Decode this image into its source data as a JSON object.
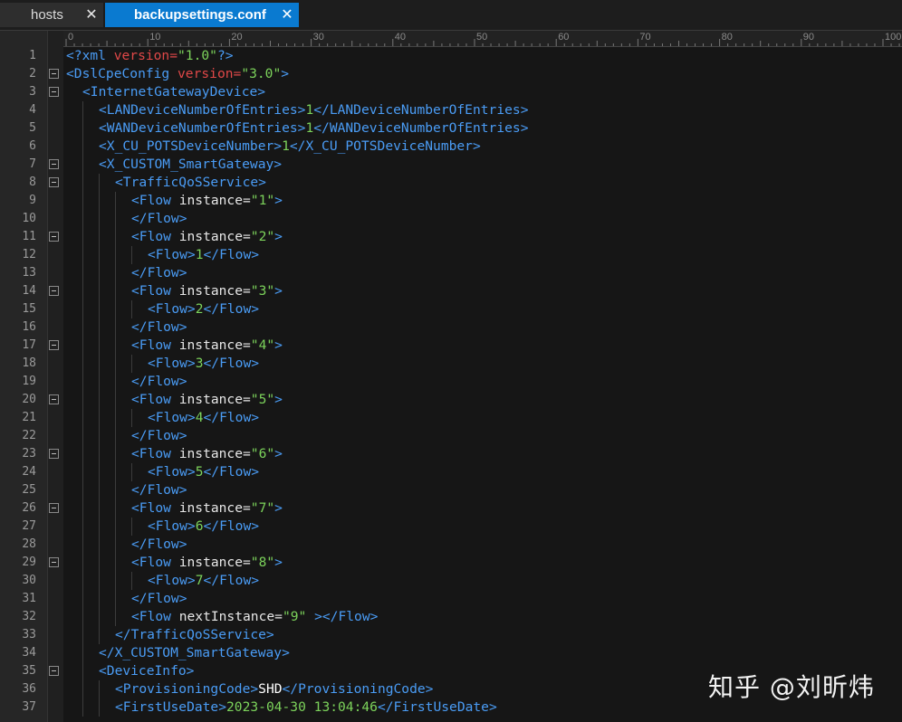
{
  "tabs": [
    {
      "label": "hosts",
      "active": false
    },
    {
      "label": "backupsettings.conf",
      "active": true
    }
  ],
  "icons": {
    "close": "close-icon",
    "fold": "fold-minus-icon"
  },
  "ruler": [
    "0",
    "10",
    "20",
    "30",
    "40",
    "50",
    "60",
    "70",
    "80",
    "90",
    "100"
  ],
  "colors": {
    "tag": "#4a9cf5",
    "attr": "#e04848",
    "string": "#7cd35b",
    "text": "#7cd35b",
    "accent_tab": "#0a7ad0"
  },
  "lines": [
    {
      "n": "1",
      "indent": 0,
      "fold": false,
      "tokens": [
        [
          "tag",
          "<?xml "
        ],
        [
          "attr",
          "version="
        ],
        [
          "str",
          "\"1.0\""
        ],
        [
          "tag",
          "?>"
        ]
      ]
    },
    {
      "n": "2",
      "indent": 0,
      "fold": true,
      "tokens": [
        [
          "tag",
          "<DslCpeConfig "
        ],
        [
          "attr",
          "version="
        ],
        [
          "str",
          "\"3.0\""
        ],
        [
          "tag",
          ">"
        ]
      ]
    },
    {
      "n": "3",
      "indent": 1,
      "fold": true,
      "tokens": [
        [
          "tag",
          "<InternetGatewayDevice>"
        ]
      ]
    },
    {
      "n": "4",
      "indent": 2,
      "fold": false,
      "tokens": [
        [
          "tag",
          "<LANDeviceNumberOfEntries>"
        ],
        [
          "txt",
          "1"
        ],
        [
          "tag",
          "</LANDeviceNumberOfEntries>"
        ]
      ]
    },
    {
      "n": "5",
      "indent": 2,
      "fold": false,
      "tokens": [
        [
          "tag",
          "<WANDeviceNumberOfEntries>"
        ],
        [
          "txt",
          "1"
        ],
        [
          "tag",
          "</WANDeviceNumberOfEntries>"
        ]
      ]
    },
    {
      "n": "6",
      "indent": 2,
      "fold": false,
      "tokens": [
        [
          "tag",
          "<X_CU_POTSDeviceNumber>"
        ],
        [
          "txt",
          "1"
        ],
        [
          "tag",
          "</X_CU_POTSDeviceNumber>"
        ]
      ]
    },
    {
      "n": "7",
      "indent": 2,
      "fold": true,
      "tokens": [
        [
          "tag",
          "<X_CUSTOM_SmartGateway>"
        ]
      ]
    },
    {
      "n": "8",
      "indent": 3,
      "fold": true,
      "tokens": [
        [
          "tag",
          "<TrafficQoSService>"
        ]
      ]
    },
    {
      "n": "9",
      "indent": 4,
      "fold": false,
      "tokens": [
        [
          "tag",
          "<Flow "
        ],
        [
          "plain",
          "instance="
        ],
        [
          "str",
          "\"1\""
        ],
        [
          "tag",
          ">"
        ]
      ]
    },
    {
      "n": "10",
      "indent": 4,
      "fold": false,
      "tokens": [
        [
          "tag",
          "</Flow>"
        ]
      ]
    },
    {
      "n": "11",
      "indent": 4,
      "fold": true,
      "tokens": [
        [
          "tag",
          "<Flow "
        ],
        [
          "plain",
          "instance="
        ],
        [
          "str",
          "\"2\""
        ],
        [
          "tag",
          ">"
        ]
      ]
    },
    {
      "n": "12",
      "indent": 5,
      "fold": false,
      "tokens": [
        [
          "tag",
          "<Flow>"
        ],
        [
          "txt",
          "1"
        ],
        [
          "tag",
          "</Flow>"
        ]
      ]
    },
    {
      "n": "13",
      "indent": 4,
      "fold": false,
      "tokens": [
        [
          "tag",
          "</Flow>"
        ]
      ]
    },
    {
      "n": "14",
      "indent": 4,
      "fold": true,
      "tokens": [
        [
          "tag",
          "<Flow "
        ],
        [
          "plain",
          "instance="
        ],
        [
          "str",
          "\"3\""
        ],
        [
          "tag",
          ">"
        ]
      ]
    },
    {
      "n": "15",
      "indent": 5,
      "fold": false,
      "tokens": [
        [
          "tag",
          "<Flow>"
        ],
        [
          "txt",
          "2"
        ],
        [
          "tag",
          "</Flow>"
        ]
      ]
    },
    {
      "n": "16",
      "indent": 4,
      "fold": false,
      "tokens": [
        [
          "tag",
          "</Flow>"
        ]
      ]
    },
    {
      "n": "17",
      "indent": 4,
      "fold": true,
      "tokens": [
        [
          "tag",
          "<Flow "
        ],
        [
          "plain",
          "instance="
        ],
        [
          "str",
          "\"4\""
        ],
        [
          "tag",
          ">"
        ]
      ]
    },
    {
      "n": "18",
      "indent": 5,
      "fold": false,
      "tokens": [
        [
          "tag",
          "<Flow>"
        ],
        [
          "txt",
          "3"
        ],
        [
          "tag",
          "</Flow>"
        ]
      ]
    },
    {
      "n": "19",
      "indent": 4,
      "fold": false,
      "tokens": [
        [
          "tag",
          "</Flow>"
        ]
      ]
    },
    {
      "n": "20",
      "indent": 4,
      "fold": true,
      "tokens": [
        [
          "tag",
          "<Flow "
        ],
        [
          "plain",
          "instance="
        ],
        [
          "str",
          "\"5\""
        ],
        [
          "tag",
          ">"
        ]
      ]
    },
    {
      "n": "21",
      "indent": 5,
      "fold": false,
      "tokens": [
        [
          "tag",
          "<Flow>"
        ],
        [
          "txt",
          "4"
        ],
        [
          "tag",
          "</Flow>"
        ]
      ]
    },
    {
      "n": "22",
      "indent": 4,
      "fold": false,
      "tokens": [
        [
          "tag",
          "</Flow>"
        ]
      ]
    },
    {
      "n": "23",
      "indent": 4,
      "fold": true,
      "tokens": [
        [
          "tag",
          "<Flow "
        ],
        [
          "plain",
          "instance="
        ],
        [
          "str",
          "\"6\""
        ],
        [
          "tag",
          ">"
        ]
      ]
    },
    {
      "n": "24",
      "indent": 5,
      "fold": false,
      "tokens": [
        [
          "tag",
          "<Flow>"
        ],
        [
          "txt",
          "5"
        ],
        [
          "tag",
          "</Flow>"
        ]
      ]
    },
    {
      "n": "25",
      "indent": 4,
      "fold": false,
      "tokens": [
        [
          "tag",
          "</Flow>"
        ]
      ]
    },
    {
      "n": "26",
      "indent": 4,
      "fold": true,
      "tokens": [
        [
          "tag",
          "<Flow "
        ],
        [
          "plain",
          "instance="
        ],
        [
          "str",
          "\"7\""
        ],
        [
          "tag",
          ">"
        ]
      ]
    },
    {
      "n": "27",
      "indent": 5,
      "fold": false,
      "tokens": [
        [
          "tag",
          "<Flow>"
        ],
        [
          "txt",
          "6"
        ],
        [
          "tag",
          "</Flow>"
        ]
      ]
    },
    {
      "n": "28",
      "indent": 4,
      "fold": false,
      "tokens": [
        [
          "tag",
          "</Flow>"
        ]
      ]
    },
    {
      "n": "29",
      "indent": 4,
      "fold": true,
      "tokens": [
        [
          "tag",
          "<Flow "
        ],
        [
          "plain",
          "instance="
        ],
        [
          "str",
          "\"8\""
        ],
        [
          "tag",
          ">"
        ]
      ]
    },
    {
      "n": "30",
      "indent": 5,
      "fold": false,
      "tokens": [
        [
          "tag",
          "<Flow>"
        ],
        [
          "txt",
          "7"
        ],
        [
          "tag",
          "</Flow>"
        ]
      ]
    },
    {
      "n": "31",
      "indent": 4,
      "fold": false,
      "tokens": [
        [
          "tag",
          "</Flow>"
        ]
      ]
    },
    {
      "n": "32",
      "indent": 4,
      "fold": false,
      "tokens": [
        [
          "tag",
          "<Flow "
        ],
        [
          "plain",
          "nextInstance="
        ],
        [
          "str",
          "\"9\""
        ],
        [
          "tag",
          " ></Flow>"
        ]
      ]
    },
    {
      "n": "33",
      "indent": 3,
      "fold": false,
      "tokens": [
        [
          "tag",
          "</TrafficQoSService>"
        ]
      ]
    },
    {
      "n": "34",
      "indent": 2,
      "fold": false,
      "tokens": [
        [
          "tag",
          "</X_CUSTOM_SmartGateway>"
        ]
      ]
    },
    {
      "n": "35",
      "indent": 2,
      "fold": true,
      "tokens": [
        [
          "tag",
          "<DeviceInfo>"
        ]
      ]
    },
    {
      "n": "36",
      "indent": 3,
      "fold": false,
      "tokens": [
        [
          "tag",
          "<ProvisioningCode>"
        ],
        [
          "txtw",
          "SHD"
        ],
        [
          "tag",
          "</ProvisioningCode>"
        ]
      ]
    },
    {
      "n": "37",
      "indent": 3,
      "fold": false,
      "tokens": [
        [
          "tag",
          "<FirstUseDate>"
        ],
        [
          "txt",
          "2023-04-30 13:04:46"
        ],
        [
          "tag",
          "</FirstUseDate>"
        ]
      ]
    }
  ],
  "watermark": "知乎 @刘昕炜"
}
